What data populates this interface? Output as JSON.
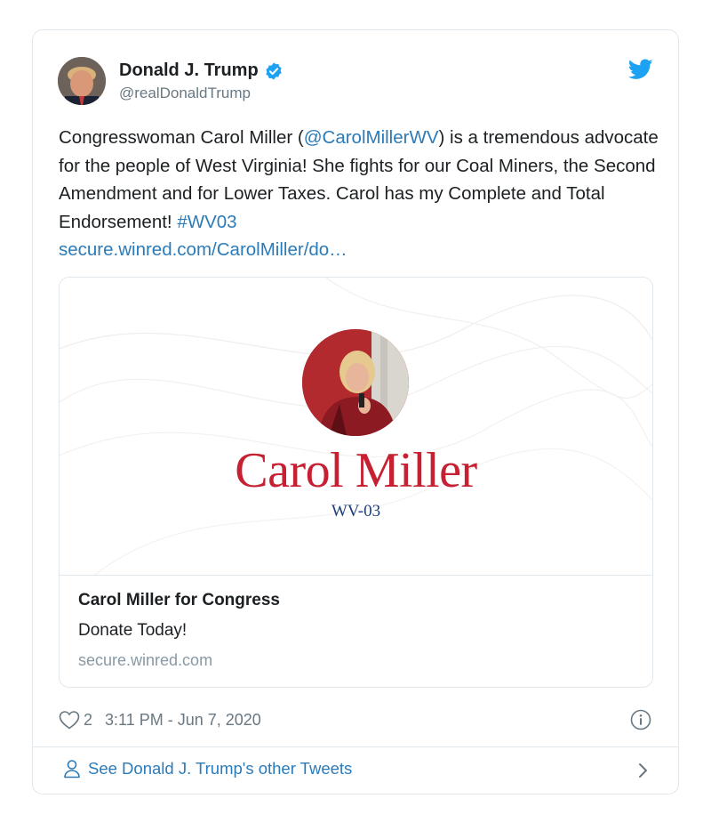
{
  "author": {
    "name": "Donald J. Trump",
    "handle": "@realDonaldTrump",
    "verified": true,
    "avatar_icon": "avatar-photo"
  },
  "tweet": {
    "text_parts": [
      {
        "text": "Congresswoman Carol Miller (",
        "link": false
      },
      {
        "text": "@CarolMillerWV",
        "link": true
      },
      {
        "text": ") is a tremendous advocate for the people of West Virginia! She fights for our Coal Miners, the Second Amendment and for Lower Taxes. Carol has my Complete and Total Endorsement! ",
        "link": false
      },
      {
        "text": "#WV03",
        "link": true
      },
      {
        "text": "\nsecure.winred.com/CarolMiller/do…",
        "link": true
      }
    ]
  },
  "card": {
    "headline": "Carol Miller",
    "district": "WV-03",
    "title": "Carol Miller for Congress",
    "description": "Donate Today!",
    "domain": "secure.winred.com"
  },
  "meta": {
    "like_count": "2",
    "timestamp": "3:11 PM - Jun 7, 2020"
  },
  "footer": {
    "more_tweets_label": "See Donald J. Trump's other Tweets"
  },
  "colors": {
    "link": "#2b7bb9",
    "twitter_blue": "#1da1f2",
    "headline_red": "#c62132",
    "district_navy": "#1f3f78"
  }
}
